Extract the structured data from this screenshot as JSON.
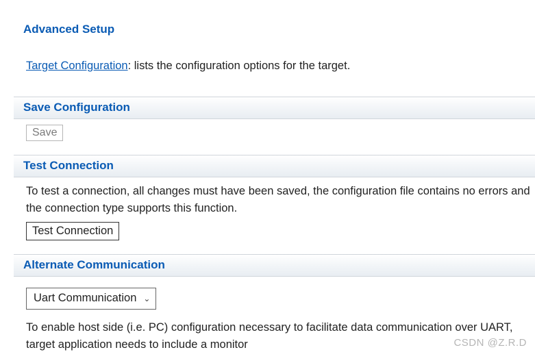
{
  "sections": {
    "advanced": {
      "title": "Advanced Setup",
      "link_text": "Target Configuration",
      "link_desc": ": lists the configuration options for the target."
    },
    "save": {
      "title": "Save Configuration",
      "button": "Save"
    },
    "test": {
      "title": "Test Connection",
      "desc": "To test a connection, all changes must have been saved, the configuration file contains no errors and the connection type supports this function.",
      "button": "Test Connection"
    },
    "alternate": {
      "title": "Alternate Communication",
      "selected": "Uart Communication",
      "desc": "To enable host side (i.e. PC) configuration necessary to facilitate data communication over UART, target application needs to include a monitor"
    }
  },
  "watermark": "CSDN @Z.R.D"
}
